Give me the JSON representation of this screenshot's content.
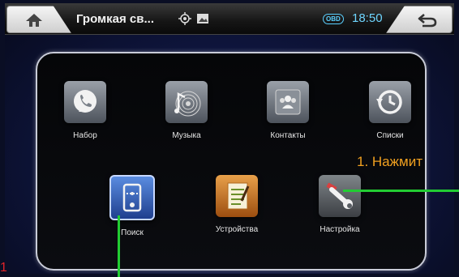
{
  "statusbar": {
    "title": "Громкая св...",
    "obd_badge": "OBD",
    "time": "18:50"
  },
  "apps_row1": [
    {
      "label": "Набор",
      "icon": "phone-icon"
    },
    {
      "label": "Музыка",
      "icon": "music-icon"
    },
    {
      "label": "Контакты",
      "icon": "contacts-icon"
    },
    {
      "label": "Списки",
      "icon": "history-icon"
    }
  ],
  "apps_row2": [
    {
      "label": "Поиск",
      "icon": "bluetooth-search-icon"
    },
    {
      "label": "Устройства",
      "icon": "devices-icon"
    },
    {
      "label": "Настройка",
      "icon": "settings-icon"
    }
  ],
  "annotation": {
    "text": "1. Нажмит",
    "color": "#f0a020",
    "line_color": "#22cc33",
    "marker_text": "1",
    "marker_color": "#e0242a"
  }
}
